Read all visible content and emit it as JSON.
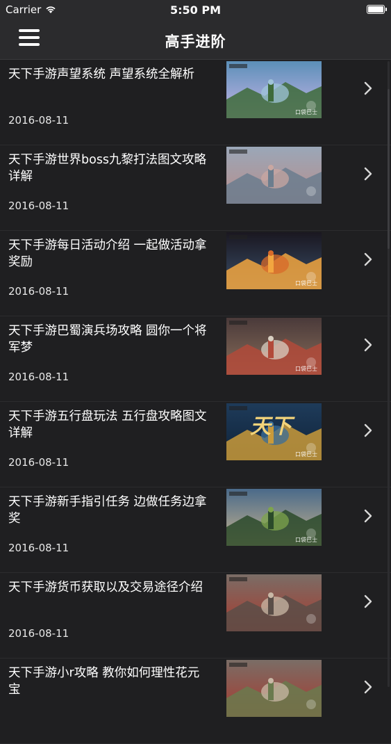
{
  "status_bar": {
    "carrier": "Carrier",
    "time": "5:50 PM"
  },
  "nav": {
    "title": "高手进阶",
    "menu_icon": "hamburger-menu-icon"
  },
  "articles": [
    {
      "title": "天下手游声望系统 声望系统全解析",
      "date": "2016-08-11",
      "thumb_tag": "口袋巴士"
    },
    {
      "title": "天下手游世界boss九黎打法图文攻略详解",
      "date": "2016-08-11",
      "thumb_tag": ""
    },
    {
      "title": "天下手游每日活动介绍 一起做活动拿奖励",
      "date": "2016-08-11",
      "thumb_tag": "口袋巴士"
    },
    {
      "title": "天下手游巴蜀演兵场攻略 圆你一个将军梦",
      "date": "2016-08-11",
      "thumb_tag": "口袋巴士"
    },
    {
      "title": "天下手游五行盘玩法 五行盘攻略图文详解",
      "date": "2016-08-11",
      "thumb_tag": "口袋巴士"
    },
    {
      "title": "天下手游新手指引任务 边做任务边拿奖",
      "date": "2016-08-11",
      "thumb_tag": "口袋巴士"
    },
    {
      "title": "天下手游货币获取以及交易途径介绍",
      "date": "2016-08-11",
      "thumb_tag": ""
    },
    {
      "title": "天下手游小r攻略 教你如何理性花元宝",
      "date": "",
      "thumb_tag": ""
    }
  ],
  "thumb_logo_text": "天下",
  "colors": {
    "background": "#1f1f21",
    "bar": "#2b2b2d",
    "text": "#ffffff",
    "chevron": "#d8d8d8"
  }
}
